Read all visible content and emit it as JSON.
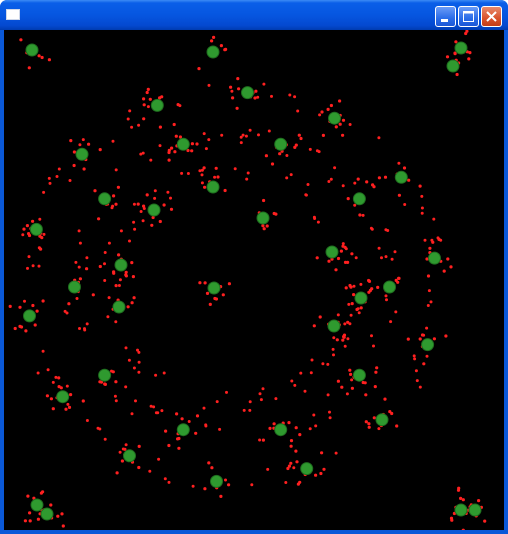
{
  "window": {
    "title": "",
    "buttons": {
      "minimize": "minimize-button",
      "maximize": "maximize-button",
      "close": "close-button"
    }
  },
  "scene": {
    "background": "#000000",
    "colors": {
      "particle": "#ff2020",
      "blob_fill": "#2f9a2f",
      "blob_edge": "#1f6e1f"
    }
  }
}
